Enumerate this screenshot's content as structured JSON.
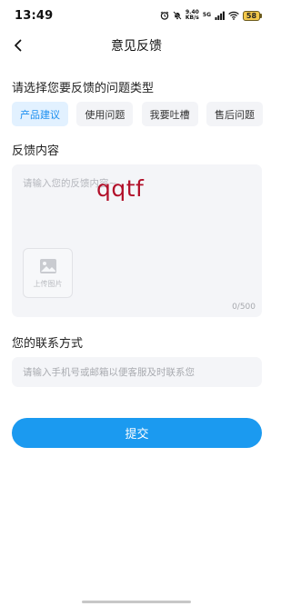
{
  "status_bar": {
    "time": "13:49",
    "net_speed_value": "9.40",
    "net_speed_unit": "KB/s",
    "network_tag": "5G",
    "battery": "58",
    "icons": [
      "alarm-icon",
      "mute-icon",
      "wifi-icon",
      "signal-icon",
      "battery-icon"
    ]
  },
  "nav": {
    "title": "意见反馈",
    "back_icon": "chevron-left-icon"
  },
  "feedback_type": {
    "label": "请选择您要反馈的问题类型",
    "options": [
      "产品建议",
      "使用问题",
      "我要吐槽",
      "售后问题"
    ],
    "selected": "产品建议"
  },
  "feedback_content": {
    "label": "反馈内容",
    "placeholder": "请输入您的反馈内容~",
    "handwriting": "qqtf",
    "upload_label": "上传图片",
    "upload_icon": "image-icon",
    "counter": "0/500"
  },
  "contact": {
    "label": "您的联系方式",
    "placeholder": "请输入手机号或邮箱以便客服及时联系您"
  },
  "submit": {
    "label": "提交"
  },
  "colors": {
    "accent": "#1b9af0",
    "chip_active_bg": "#e2f1ff",
    "chip_active_text": "#1a8ef0",
    "input_bg": "#f4f5f8",
    "handwriting": "#b2102a"
  }
}
